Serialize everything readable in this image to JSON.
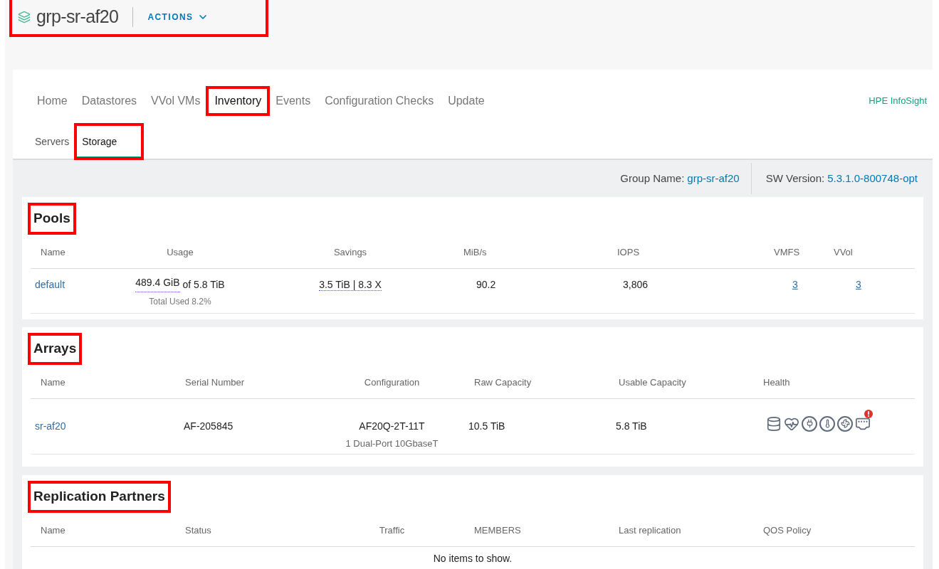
{
  "header": {
    "title": "grp-sr-af20",
    "actions_label": "ACTIONS",
    "highlighted": true
  },
  "nav": {
    "tabs": [
      {
        "label": "Home",
        "selected": false,
        "highlighted": false
      },
      {
        "label": "Datastores",
        "selected": false,
        "highlighted": false
      },
      {
        "label": "VVol VMs",
        "selected": false,
        "highlighted": false
      },
      {
        "label": "Inventory",
        "selected": true,
        "highlighted": true
      },
      {
        "label": "Events",
        "selected": false,
        "highlighted": false
      },
      {
        "label": "Configuration Checks",
        "selected": false,
        "highlighted": false
      },
      {
        "label": "Update",
        "selected": false,
        "highlighted": false
      }
    ],
    "link": "HPE InfoSight"
  },
  "subtabs": [
    {
      "label": "Servers",
      "selected": false,
      "highlighted": false
    },
    {
      "label": "Storage",
      "selected": true,
      "highlighted": true
    }
  ],
  "info": {
    "group_label": "Group Name:",
    "group_value": "grp-sr-af20",
    "version_label": "SW Version:",
    "version_value": "5.3.1.0-800748-opt"
  },
  "pools": {
    "title": "Pools",
    "highlighted": true,
    "columns": [
      "Name",
      "Usage",
      "Savings",
      "MiB/s",
      "IOPS",
      "VMFS",
      "VVol"
    ],
    "rows": [
      {
        "name": "default",
        "usage_used": "489.4 GiB",
        "usage_rest": "of 5.8 TiB",
        "usage_note": "Total Used 8.2%",
        "savings": "3.5 TiB | 8.3 X",
        "mibs": "90.2",
        "iops": "3,806",
        "vmfs": "3",
        "vvol": "3"
      }
    ]
  },
  "arrays": {
    "title": "Arrays",
    "highlighted": true,
    "columns": [
      "Name",
      "Serial Number",
      "Configuration",
      "Raw Capacity",
      "Usable Capacity",
      "Health"
    ],
    "rows": [
      {
        "name": "sr-af20",
        "serial": "AF-205845",
        "configuration": "AF20Q-2T-11T",
        "configuration_note": "1 Dual-Port 10GbaseT",
        "raw": "10.5 TiB",
        "usable": "5.8 TiB",
        "health": [
          {
            "kind": "disk",
            "alert": false
          },
          {
            "kind": "heart",
            "alert": false
          },
          {
            "kind": "power",
            "alert": false
          },
          {
            "kind": "temperature",
            "alert": false
          },
          {
            "kind": "fan",
            "alert": false
          },
          {
            "kind": "network",
            "alert": true
          }
        ]
      }
    ]
  },
  "replication": {
    "title": "Replication Partners",
    "highlighted": true,
    "columns": [
      "Name",
      "Status",
      "Traffic",
      "MEMBERS",
      "Last replication",
      "QOS Policy"
    ],
    "empty_text": "No items to show."
  }
}
